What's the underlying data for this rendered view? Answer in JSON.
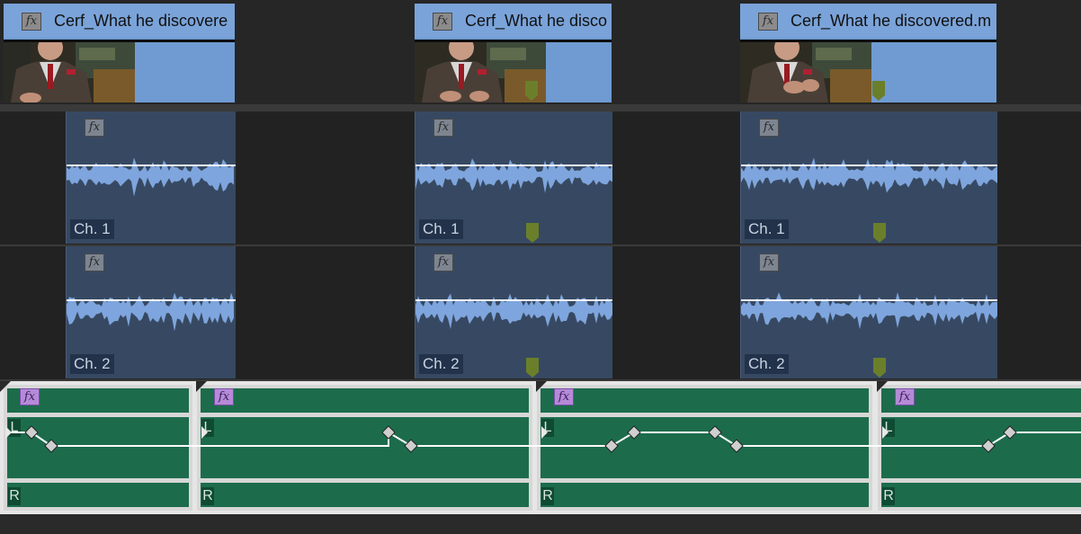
{
  "video_track": {
    "clips": [
      {
        "name": "Cerf_What he discovere",
        "fx": "fx"
      },
      {
        "name": "Cerf_What he disco",
        "fx": "fx"
      },
      {
        "name": "Cerf_What he discovered.m",
        "fx": "fx"
      }
    ]
  },
  "audio_track_1": {
    "channel_label": "Ch. 1",
    "clips": [
      {
        "fx": "fx"
      },
      {
        "fx": "fx"
      },
      {
        "fx": "fx"
      }
    ]
  },
  "audio_track_2": {
    "channel_label": "Ch. 2",
    "clips": [
      {
        "fx": "fx"
      },
      {
        "fx": "fx"
      },
      {
        "fx": "fx"
      }
    ]
  },
  "adjustment_track": {
    "left_label": "L",
    "right_label": "R",
    "clips": [
      {
        "fx": "fx"
      },
      {
        "fx": "fx"
      },
      {
        "fx": "fx"
      },
      {
        "fx": "fx"
      }
    ]
  },
  "colors": {
    "video_clip": "#7aa3d9",
    "audio_clip": "#374962",
    "waveform": "#7ea5dd",
    "adjustment_lane": "#1c6c4c",
    "marker": "#6b7f2a",
    "fx_badge_adjustment": "#b58ad8"
  }
}
